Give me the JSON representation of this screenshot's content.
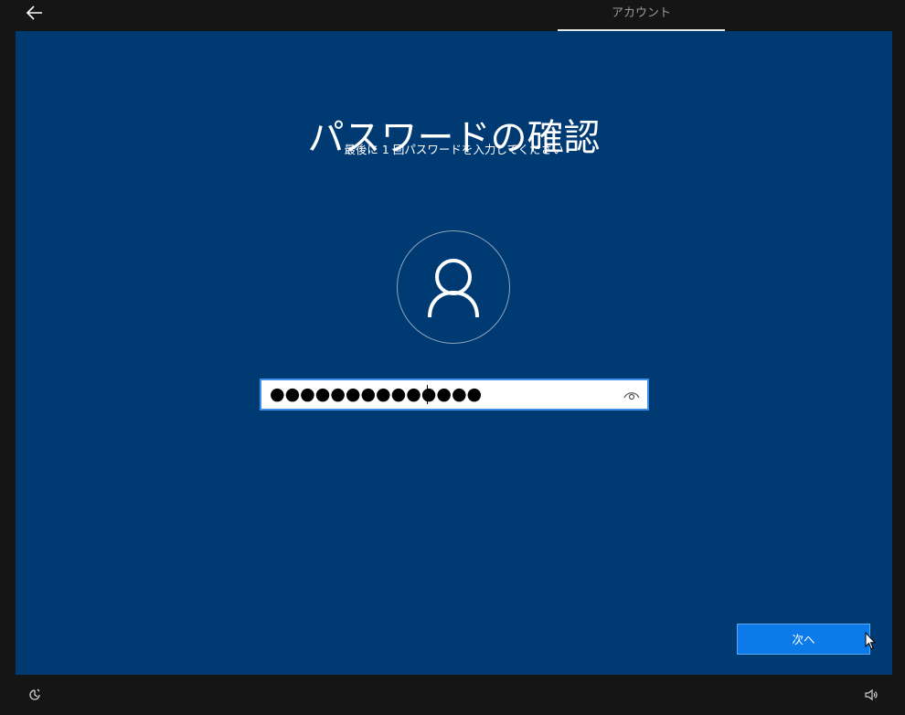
{
  "header": {
    "back_icon": "arrow-left-icon",
    "tab_label": "アカウント"
  },
  "main": {
    "title": "パスワードの確認",
    "subtitle": "最後に 1 回パスワードを入力してください",
    "avatar_icon": "person-icon",
    "password_field": {
      "masked_value": "●●●●●●●●●●●●●●",
      "reveal_icon": "eye-icon"
    },
    "next_button_label": "次へ"
  },
  "footer": {
    "left_icon": "ease-of-access-icon",
    "right_icon": "volume-icon"
  },
  "colors": {
    "panel_bg": "#003a73",
    "chrome_bg": "#151515",
    "accent": "#0c7ae8",
    "field_border": "#3c8fe6"
  }
}
